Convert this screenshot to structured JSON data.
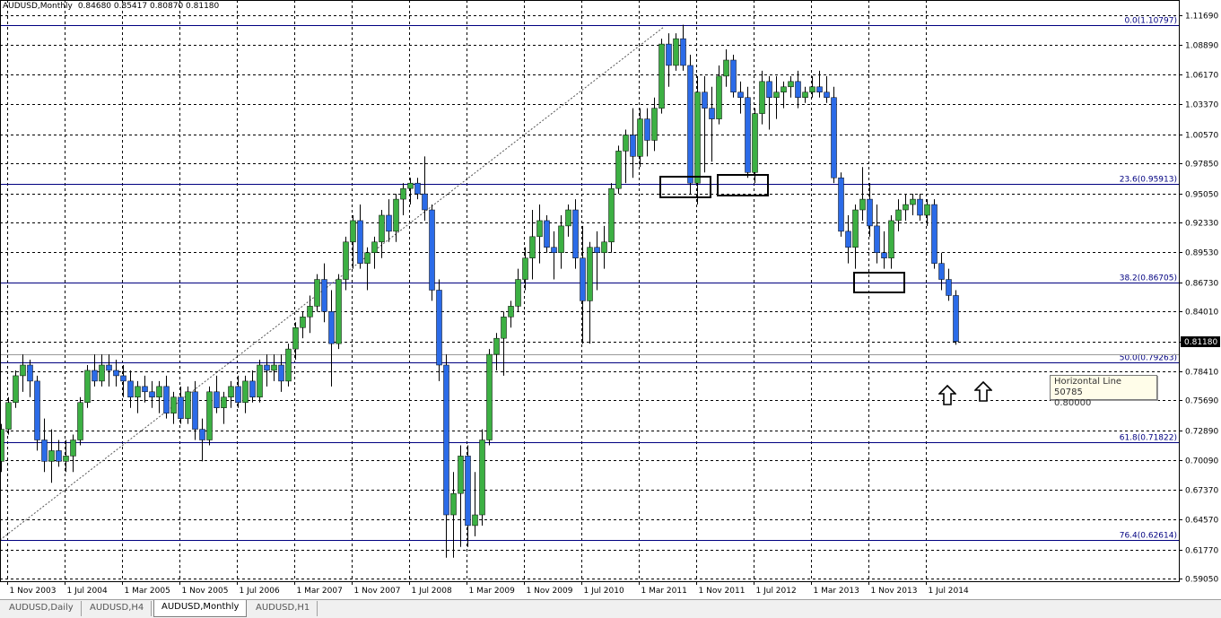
{
  "window": {
    "title": "AUDUSD,Monthly",
    "ohlc": "0.84680 0.85417 0.80870 0.81180"
  },
  "colors": {
    "bull": "#3cb043",
    "bear": "#2b6be8",
    "wick": "#000000",
    "fib": "#000080",
    "grid": "#000000"
  },
  "tabs": [
    {
      "label": "AUDUSD,Daily",
      "active": false
    },
    {
      "label": "AUDUSD,H4",
      "active": false
    },
    {
      "label": "AUDUSD,Monthly",
      "active": true
    },
    {
      "label": "AUDUSD,H1",
      "active": false
    }
  ],
  "tooltip": {
    "line1": "Horizontal Line 50785",
    "line2": "0.80000"
  },
  "annotations": {
    "arrows": [
      "up-arrow-icon",
      "up-arrow-icon"
    ],
    "boxes": 3
  },
  "chart_data": {
    "type": "candlestick",
    "symbol": "AUDUSD",
    "timeframe": "Monthly",
    "current_price": "0.81180",
    "ylim": [
      0.5905,
      1.1169
    ],
    "y_ticks": [
      "1.11690",
      "1.08890",
      "1.06170",
      "1.03370",
      "1.00570",
      "0.97850",
      "0.95050",
      "0.92330",
      "0.89530",
      "0.86730",
      "0.84010",
      "0.81210",
      "0.78410",
      "0.75690",
      "0.72890",
      "0.70090",
      "0.67370",
      "0.64570",
      "0.61770",
      "0.59050"
    ],
    "x_ticks": [
      "1 Nov 2003",
      "1 Jul 2004",
      "1 Mar 2005",
      "1 Nov 2005",
      "1 Jul 2006",
      "1 Mar 2007",
      "1 Nov 2007",
      "1 Jul 2008",
      "1 Mar 2009",
      "1 Nov 2009",
      "1 Jul 2010",
      "1 Mar 2011",
      "1 Nov 2011",
      "1 Jul 2012",
      "1 Mar 2013",
      "1 Nov 2013",
      "1 Jul 2014"
    ],
    "fibonacci": [
      {
        "label": "0.0(1.10797)",
        "value": 1.10797
      },
      {
        "label": "23.6(0.95913)",
        "value": 0.95913
      },
      {
        "label": "38.2(0.86705)",
        "value": 0.86705
      },
      {
        "label": "50.0(0.79263)",
        "value": 0.79263
      },
      {
        "label": "61.8(0.71822)",
        "value": 0.71822
      },
      {
        "label": "76.4(0.62614)",
        "value": 0.62614
      }
    ],
    "candles": [
      [
        0.7,
        0.735,
        0.69,
        0.73
      ],
      [
        0.73,
        0.76,
        0.725,
        0.755
      ],
      [
        0.755,
        0.785,
        0.75,
        0.78
      ],
      [
        0.78,
        0.8,
        0.765,
        0.79
      ],
      [
        0.79,
        0.795,
        0.76,
        0.775
      ],
      [
        0.775,
        0.78,
        0.71,
        0.72
      ],
      [
        0.72,
        0.74,
        0.69,
        0.7
      ],
      [
        0.7,
        0.73,
        0.68,
        0.71
      ],
      [
        0.71,
        0.72,
        0.695,
        0.7
      ],
      [
        0.7,
        0.72,
        0.69,
        0.705
      ],
      [
        0.705,
        0.725,
        0.69,
        0.72
      ],
      [
        0.72,
        0.76,
        0.715,
        0.755
      ],
      [
        0.755,
        0.79,
        0.75,
        0.785
      ],
      [
        0.785,
        0.8,
        0.77,
        0.775
      ],
      [
        0.775,
        0.8,
        0.77,
        0.79
      ],
      [
        0.79,
        0.8,
        0.77,
        0.785
      ],
      [
        0.785,
        0.795,
        0.77,
        0.78
      ],
      [
        0.78,
        0.79,
        0.76,
        0.775
      ],
      [
        0.775,
        0.785,
        0.75,
        0.76
      ],
      [
        0.76,
        0.775,
        0.745,
        0.77
      ],
      [
        0.77,
        0.78,
        0.755,
        0.765
      ],
      [
        0.765,
        0.775,
        0.75,
        0.76
      ],
      [
        0.76,
        0.775,
        0.745,
        0.77
      ],
      [
        0.77,
        0.78,
        0.74,
        0.745
      ],
      [
        0.745,
        0.765,
        0.735,
        0.76
      ],
      [
        0.76,
        0.77,
        0.735,
        0.74
      ],
      [
        0.74,
        0.77,
        0.735,
        0.765
      ],
      [
        0.765,
        0.775,
        0.72,
        0.73
      ],
      [
        0.73,
        0.74,
        0.7,
        0.72
      ],
      [
        0.72,
        0.77,
        0.715,
        0.765
      ],
      [
        0.765,
        0.78,
        0.745,
        0.75
      ],
      [
        0.75,
        0.765,
        0.735,
        0.76
      ],
      [
        0.76,
        0.775,
        0.75,
        0.77
      ],
      [
        0.77,
        0.78,
        0.75,
        0.755
      ],
      [
        0.755,
        0.78,
        0.745,
        0.775
      ],
      [
        0.775,
        0.785,
        0.755,
        0.76
      ],
      [
        0.76,
        0.795,
        0.755,
        0.79
      ],
      [
        0.79,
        0.8,
        0.77,
        0.785
      ],
      [
        0.785,
        0.8,
        0.775,
        0.79
      ],
      [
        0.79,
        0.8,
        0.765,
        0.775
      ],
      [
        0.775,
        0.81,
        0.77,
        0.805
      ],
      [
        0.805,
        0.83,
        0.795,
        0.825
      ],
      [
        0.825,
        0.84,
        0.815,
        0.835
      ],
      [
        0.835,
        0.855,
        0.82,
        0.845
      ],
      [
        0.845,
        0.875,
        0.84,
        0.87
      ],
      [
        0.87,
        0.885,
        0.83,
        0.84
      ],
      [
        0.84,
        0.86,
        0.77,
        0.81
      ],
      [
        0.81,
        0.875,
        0.805,
        0.87
      ],
      [
        0.87,
        0.91,
        0.86,
        0.905
      ],
      [
        0.905,
        0.93,
        0.88,
        0.925
      ],
      [
        0.925,
        0.94,
        0.88,
        0.885
      ],
      [
        0.885,
        0.9,
        0.86,
        0.895
      ],
      [
        0.895,
        0.91,
        0.88,
        0.905
      ],
      [
        0.905,
        0.935,
        0.89,
        0.93
      ],
      [
        0.93,
        0.945,
        0.905,
        0.915
      ],
      [
        0.915,
        0.95,
        0.905,
        0.945
      ],
      [
        0.945,
        0.96,
        0.93,
        0.955
      ],
      [
        0.955,
        0.965,
        0.94,
        0.96
      ],
      [
        0.96,
        0.965,
        0.945,
        0.95
      ],
      [
        0.95,
        0.985,
        0.925,
        0.935
      ],
      [
        0.935,
        0.94,
        0.85,
        0.86
      ],
      [
        0.86,
        0.87,
        0.775,
        0.79
      ],
      [
        0.79,
        0.8,
        0.61,
        0.65
      ],
      [
        0.65,
        0.69,
        0.61,
        0.67
      ],
      [
        0.67,
        0.715,
        0.62,
        0.705
      ],
      [
        0.705,
        0.715,
        0.62,
        0.64
      ],
      [
        0.64,
        0.69,
        0.63,
        0.65
      ],
      [
        0.65,
        0.73,
        0.64,
        0.72
      ],
      [
        0.72,
        0.805,
        0.715,
        0.8
      ],
      [
        0.8,
        0.82,
        0.785,
        0.815
      ],
      [
        0.815,
        0.84,
        0.78,
        0.835
      ],
      [
        0.835,
        0.85,
        0.825,
        0.845
      ],
      [
        0.845,
        0.88,
        0.84,
        0.87
      ],
      [
        0.87,
        0.9,
        0.86,
        0.89
      ],
      [
        0.89,
        0.935,
        0.87,
        0.91
      ],
      [
        0.91,
        0.94,
        0.885,
        0.925
      ],
      [
        0.925,
        0.93,
        0.895,
        0.9
      ],
      [
        0.9,
        0.915,
        0.87,
        0.895
      ],
      [
        0.895,
        0.93,
        0.88,
        0.92
      ],
      [
        0.92,
        0.94,
        0.91,
        0.935
      ],
      [
        0.935,
        0.945,
        0.88,
        0.89
      ],
      [
        0.89,
        0.92,
        0.81,
        0.85
      ],
      [
        0.85,
        0.905,
        0.81,
        0.9
      ],
      [
        0.9,
        0.915,
        0.86,
        0.895
      ],
      [
        0.895,
        0.92,
        0.88,
        0.905
      ],
      [
        0.905,
        0.96,
        0.895,
        0.955
      ],
      [
        0.955,
        0.995,
        0.95,
        0.99
      ],
      [
        0.99,
        1.01,
        0.96,
        1.005
      ],
      [
        1.005,
        1.03,
        0.965,
        0.985
      ],
      [
        0.985,
        1.03,
        0.975,
        1.02
      ],
      [
        1.02,
        1.03,
        0.985,
        1.0
      ],
      [
        1.0,
        1.04,
        0.99,
        1.03
      ],
      [
        1.03,
        1.095,
        1.025,
        1.09
      ],
      [
        1.09,
        1.1,
        1.05,
        1.07
      ],
      [
        1.07,
        1.1,
        1.065,
        1.095
      ],
      [
        1.095,
        1.108,
        1.065,
        1.07
      ],
      [
        1.07,
        1.08,
        0.95,
        0.96
      ],
      [
        0.96,
        1.06,
        0.94,
        1.045
      ],
      [
        1.045,
        1.06,
        0.97,
        1.03
      ],
      [
        1.03,
        1.05,
        0.98,
        1.02
      ],
      [
        1.02,
        1.07,
        1.015,
        1.06
      ],
      [
        1.06,
        1.085,
        1.05,
        1.075
      ],
      [
        1.075,
        1.08,
        1.04,
        1.045
      ],
      [
        1.045,
        1.055,
        1.025,
        1.04
      ],
      [
        1.04,
        1.05,
        0.965,
        0.97
      ],
      [
        0.97,
        1.03,
        0.96,
        1.025
      ],
      [
        1.025,
        1.065,
        1.015,
        1.055
      ],
      [
        1.055,
        1.06,
        1.01,
        1.04
      ],
      [
        1.04,
        1.06,
        1.02,
        1.045
      ],
      [
        1.045,
        1.055,
        1.03,
        1.05
      ],
      [
        1.05,
        1.06,
        1.04,
        1.055
      ],
      [
        1.055,
        1.065,
        1.03,
        1.04
      ],
      [
        1.04,
        1.05,
        1.035,
        1.045
      ],
      [
        1.045,
        1.06,
        1.04,
        1.05
      ],
      [
        1.05,
        1.065,
        1.04,
        1.045
      ],
      [
        1.045,
        1.06,
        1.035,
        1.04
      ],
      [
        1.04,
        1.05,
        0.96,
        0.965
      ],
      [
        0.965,
        0.97,
        0.91,
        0.915
      ],
      [
        0.915,
        0.93,
        0.885,
        0.9
      ],
      [
        0.9,
        0.94,
        0.88,
        0.935
      ],
      [
        0.935,
        0.975,
        0.925,
        0.945
      ],
      [
        0.945,
        0.96,
        0.91,
        0.92
      ],
      [
        0.92,
        0.94,
        0.885,
        0.895
      ],
      [
        0.895,
        0.915,
        0.88,
        0.89
      ],
      [
        0.89,
        0.93,
        0.88,
        0.925
      ],
      [
        0.925,
        0.945,
        0.915,
        0.935
      ],
      [
        0.935,
        0.95,
        0.925,
        0.94
      ],
      [
        0.94,
        0.95,
        0.93,
        0.945
      ],
      [
        0.945,
        0.95,
        0.925,
        0.93
      ],
      [
        0.93,
        0.945,
        0.92,
        0.94
      ],
      [
        0.94,
        0.945,
        0.88,
        0.885
      ],
      [
        0.885,
        0.895,
        0.86,
        0.87
      ],
      [
        0.87,
        0.88,
        0.85,
        0.855
      ],
      [
        0.855,
        0.86,
        0.809,
        0.812
      ]
    ]
  }
}
